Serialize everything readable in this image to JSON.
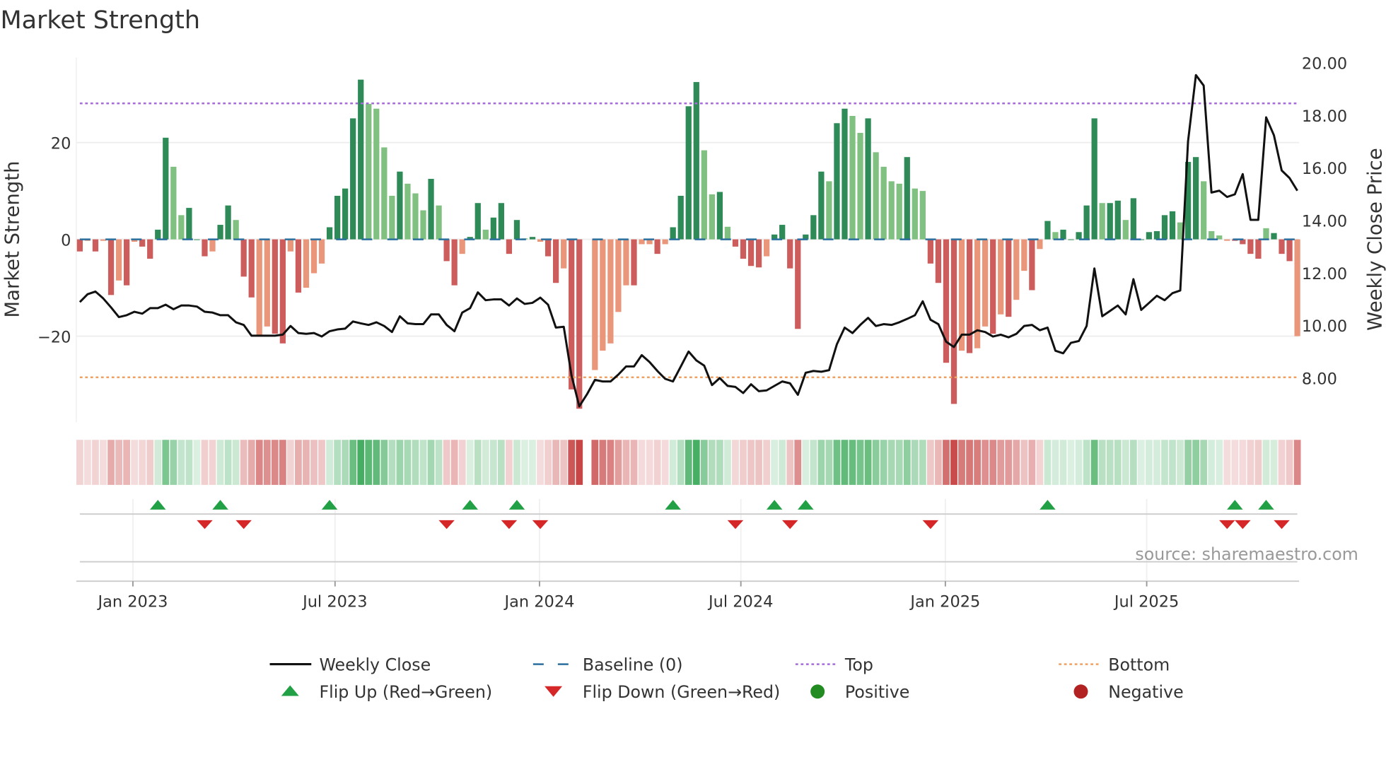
{
  "title": "Market Strength",
  "source": "source: sharemaestro.com",
  "colors": {
    "strong_green": "#2e8b57",
    "weak_green": "#80c080",
    "strong_red": "#cd5c5c",
    "weak_red": "#e9967a",
    "price_line": "#111111",
    "baseline": "#2a6f9e",
    "top": "#a56cd9",
    "bottom": "#f0a060",
    "flip_up": "#22a045",
    "flip_down": "#d62728",
    "positive": "#228b22",
    "negative": "#b22222"
  },
  "chart_data": {
    "type": "bar+line",
    "title": "Market Strength",
    "ylabel_left": "Market Strength",
    "ylabel_right": "Weekly Close Price",
    "ylim_left": [
      -37,
      38
    ],
    "ylim_right": [
      6.5,
      20.2
    ],
    "left_ticks": [
      {
        "v": 20,
        "label": "20"
      },
      {
        "v": 0,
        "label": "0"
      },
      {
        "v": -20,
        "label": "−20"
      }
    ],
    "right_ticks": [
      {
        "v": 20,
        "label": "20.00"
      },
      {
        "v": 18,
        "label": "18.00"
      },
      {
        "v": 16,
        "label": "16.00"
      },
      {
        "v": 14,
        "label": "14.00"
      },
      {
        "v": 12,
        "label": "12.00"
      },
      {
        "v": 10,
        "label": "10.00"
      },
      {
        "v": 8,
        "label": "8.00"
      }
    ],
    "x_ticks": [
      {
        "week": 6.8,
        "label": "Jan 2023"
      },
      {
        "week": 32.7,
        "label": "Jul 2023"
      },
      {
        "week": 58.9,
        "label": "Jan 2024"
      },
      {
        "week": 84.7,
        "label": "Jul 2024"
      },
      {
        "week": 110.9,
        "label": "Jan 2025"
      },
      {
        "week": 136.7,
        "label": "Jul 2025"
      }
    ],
    "top_level": 28.1,
    "bottom_level": -28.5,
    "baseline": 0,
    "strength": [
      -2.5,
      -0.3,
      -2.5,
      -0.3,
      -11.5,
      -8.5,
      -9.5,
      -0.5,
      -1.5,
      -4,
      2,
      21,
      15,
      5,
      6.5,
      0,
      -3.5,
      -2.5,
      3,
      7,
      4,
      -7.7,
      -12,
      -20,
      -18,
      -19.5,
      -21.5,
      -2.5,
      -11,
      -10,
      -7,
      -5,
      2.5,
      9,
      10.5,
      25,
      33,
      28,
      27,
      19,
      9,
      14,
      11.5,
      9.5,
      6,
      12.5,
      7,
      -4.5,
      -9.5,
      -3,
      0.5,
      7.5,
      2,
      4.5,
      7.5,
      -3,
      4,
      0.2,
      0.5,
      -0.5,
      -3.5,
      -9,
      -6,
      -31,
      -35,
      null,
      -27,
      -23,
      -21.5,
      -15,
      -9.5,
      -9.5,
      -1,
      -1,
      -3,
      -1,
      2.5,
      9,
      27.5,
      32.5,
      18.4,
      9.3,
      9.8,
      2.6,
      -1.5,
      -4,
      -5.5,
      -5.8,
      -3.5,
      1,
      3,
      -6,
      -18.5,
      1,
      5,
      14,
      12,
      24,
      27,
      25.5,
      22,
      25,
      18,
      15,
      12,
      11.5,
      17,
      10.5,
      10,
      -5,
      -9,
      -25.5,
      -34,
      -23,
      -23.5,
      -22.5,
      -18,
      -19.5,
      -15.5,
      -16,
      -12.5,
      -6.5,
      -10.5,
      -2,
      3.8,
      1.5,
      2,
      0,
      1.5,
      7,
      25,
      7.5,
      7.5,
      8,
      4,
      8.5,
      0,
      1.5,
      1.7,
      5,
      5.8,
      3.5,
      16,
      17,
      12,
      1.7,
      0.8,
      -0.3,
      -0.3,
      -1,
      -3,
      -4,
      2.3,
      1.3,
      -3,
      -4.5,
      -20
    ],
    "momentum": [
      "s",
      "w",
      "s",
      "w",
      "s",
      "w",
      "s",
      "w",
      "s",
      "s",
      "s",
      "s",
      "w",
      "w",
      "s",
      "s",
      "s",
      "w",
      "s",
      "s",
      "w",
      "s",
      "s",
      "w",
      "w",
      "s",
      "s",
      "w",
      "s",
      "w",
      "w",
      "w",
      "s",
      "s",
      "s",
      "s",
      "s",
      "w",
      "w",
      "w",
      "w",
      "s",
      "w",
      "w",
      "w",
      "s",
      "w",
      "s",
      "s",
      "w",
      "s",
      "s",
      "w",
      "s",
      "s",
      "s",
      "s",
      "w",
      "s",
      "w",
      "s",
      "s",
      "w",
      "s",
      "s",
      "s",
      "w",
      "w",
      "w",
      "w",
      "w",
      "s",
      "w",
      "w",
      "s",
      "w",
      "s",
      "s",
      "s",
      "s",
      "w",
      "w",
      "s",
      "w",
      "s",
      "s",
      "s",
      "s",
      "w",
      "s",
      "s",
      "s",
      "s",
      "s",
      "s",
      "s",
      "w",
      "s",
      "s",
      "w",
      "w",
      "s",
      "w",
      "w",
      "w",
      "w",
      "s",
      "w",
      "w",
      "s",
      "s",
      "s",
      "s",
      "w",
      "s",
      "w",
      "w",
      "s",
      "w",
      "s",
      "w",
      "w",
      "s",
      "w",
      "s",
      "w",
      "s",
      "s",
      "s",
      "s",
      "s",
      "w",
      "s",
      "s",
      "w",
      "s",
      "s",
      "s",
      "s",
      "s",
      "s",
      "w",
      "s",
      "s",
      "w",
      "w",
      "w",
      "w",
      "s",
      "s",
      "s",
      "s",
      "w",
      "s",
      "s",
      "s"
    ],
    "weekly_close": [
      10.89,
      11.19,
      11.29,
      11.03,
      10.69,
      10.32,
      10.39,
      10.52,
      10.45,
      10.66,
      10.66,
      10.79,
      10.62,
      10.76,
      10.76,
      10.72,
      10.52,
      10.49,
      10.39,
      10.39,
      10.12,
      10.02,
      9.61,
      9.61,
      9.61,
      9.61,
      9.65,
      9.98,
      9.71,
      9.68,
      9.71,
      9.58,
      9.78,
      9.85,
      9.88,
      10.15,
      10.08,
      10.02,
      10.12,
      9.98,
      9.75,
      10.35,
      10.08,
      10.05,
      10.05,
      10.42,
      10.42,
      10.02,
      9.78,
      10.49,
      10.66,
      11.26,
      10.96,
      10.99,
      10.99,
      10.76,
      11.03,
      10.82,
      10.86,
      11.06,
      10.79,
      9.92,
      9.95,
      8.1,
      6.92,
      7.39,
      7.93,
      7.87,
      7.87,
      8.13,
      8.44,
      8.44,
      8.87,
      8.61,
      8.27,
      7.97,
      7.87,
      8.44,
      9.01,
      8.67,
      8.47,
      7.73,
      8.0,
      7.7,
      7.66,
      7.43,
      7.76,
      7.5,
      7.53,
      7.7,
      7.87,
      7.8,
      7.36,
      8.2,
      8.27,
      8.24,
      8.3,
      9.28,
      9.92,
      9.71,
      10.02,
      10.29,
      9.98,
      10.05,
      10.02,
      10.12,
      10.25,
      10.39,
      10.92,
      10.22,
      10.05,
      9.38,
      9.18,
      9.65,
      9.65,
      9.82,
      9.75,
      9.58,
      9.65,
      9.55,
      9.68,
      9.98,
      10.02,
      9.82,
      9.92,
      9.04,
      8.94,
      9.34,
      9.41,
      9.98,
      12.17,
      10.35,
      10.55,
      10.76,
      10.42,
      11.76,
      10.59,
      10.86,
      11.13,
      10.96,
      11.23,
      11.33,
      17.01,
      19.53,
      19.13,
      15.06,
      15.13,
      14.89,
      14.99,
      15.76,
      14.02,
      14.02,
      17.92,
      17.24,
      15.9,
      15.61,
      15.13
    ],
    "flip_up_weeks": [
      10,
      18,
      32,
      50,
      56,
      76,
      89,
      93,
      124,
      148,
      152
    ],
    "flip_down_weeks": [
      16,
      21,
      47,
      55,
      59,
      84,
      91,
      109,
      147,
      149,
      154
    ],
    "legend": {
      "placement": "bottom",
      "items": [
        {
          "key": "close",
          "label": "Weekly Close"
        },
        {
          "key": "baseline",
          "label": "Baseline (0)"
        },
        {
          "key": "top",
          "label": "Top"
        },
        {
          "key": "bottom",
          "label": "Bottom"
        },
        {
          "key": "up",
          "label": "Flip Up (Red→Green)"
        },
        {
          "key": "down",
          "label": "Flip Down (Green→Red)"
        },
        {
          "key": "pos",
          "label": "Positive"
        },
        {
          "key": "neg",
          "label": "Negative"
        }
      ]
    }
  }
}
